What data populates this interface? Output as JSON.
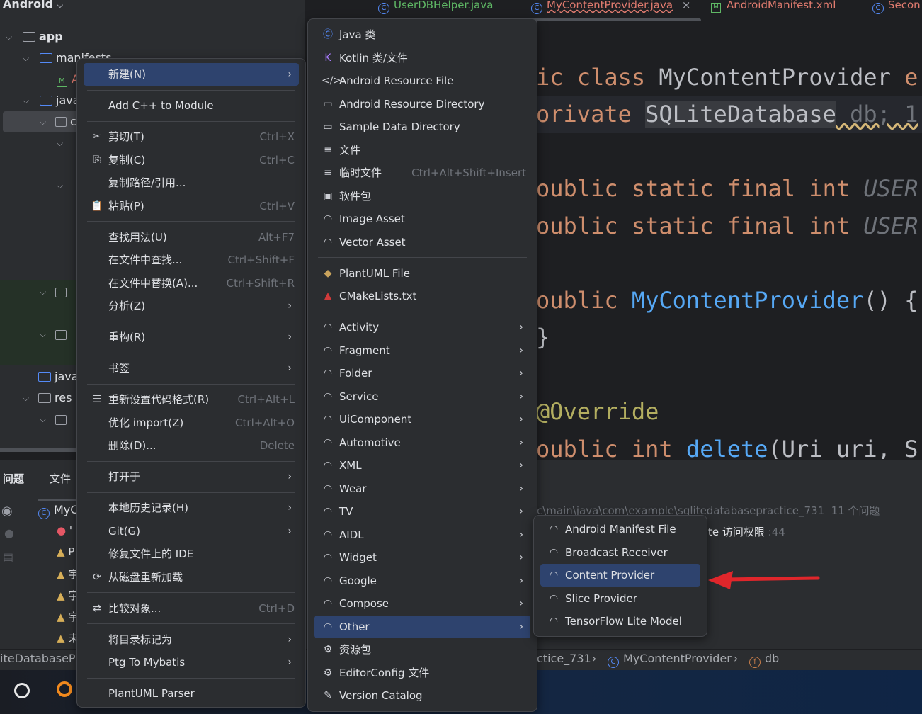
{
  "project": {
    "view_label": "Android",
    "tree": [
      {
        "label": "app",
        "depth": 0,
        "icon": "module-folder-icon"
      },
      {
        "label": "manifests",
        "depth": 1,
        "icon": "folder-icon"
      },
      {
        "label": "A",
        "depth": 2,
        "icon": "manifest-icon"
      },
      {
        "label": "java",
        "depth": 1,
        "icon": "folder-icon"
      },
      {
        "label": "c",
        "depth": 2,
        "icon": "package-icon"
      }
    ],
    "lower_tree": [
      {
        "label": "java",
        "icon": "generated-java-folder-icon"
      },
      {
        "label": "res",
        "icon": "res-folder-icon"
      }
    ]
  },
  "tabs": [
    {
      "label": "UserDBHelper.java",
      "color": "#5fb865"
    },
    {
      "label": "MyContentProvider.java",
      "color": "#e07b6f",
      "active": true
    },
    {
      "label": "AndroidManifest.xml",
      "color": "#e07b6f"
    },
    {
      "label": "Secon",
      "color": "#e07b6f"
    }
  ],
  "code": [
    [
      "ic class ",
      "MyContentProvider",
      " e"
    ],
    [
      "orivate ",
      "SQLiteDatabase",
      " db; 1"
    ],
    [
      "oublic static final int ",
      "USER"
    ],
    [
      "oublic static final int ",
      "USER"
    ],
    [
      "oublic ",
      "MyContentProvider",
      "() {"
    ],
    [
      "}"
    ],
    [
      "@Override"
    ],
    [
      "oublic int ",
      "delete",
      "(Uri uri, S"
    ]
  ],
  "bottom": {
    "tabs": [
      "问题",
      "文件"
    ],
    "file_row": "MyC",
    "path": "c\\main\\java\\com\\example\\sqlitedatabasepractice_731  11 个问题",
    "problem_text": "te 访问权限",
    "problem_line": ":44",
    "rows": [
      "'",
      "P",
      "宇",
      "宇",
      "宇",
      "未"
    ]
  },
  "breadcrumb": {
    "left": "iteDatabasePra",
    "pkg": "ctice_731",
    "class": "MyContentProvider",
    "field": "db"
  },
  "menu1": [
    {
      "label": "新建(N)",
      "submenu": true,
      "selected": true
    },
    {
      "sep": true
    },
    {
      "label": "Add C++ to Module"
    },
    {
      "sep": true
    },
    {
      "label": "剪切(T)",
      "shortcut": "Ctrl+X",
      "icon": "✂",
      "name": "cut"
    },
    {
      "label": "复制(C)",
      "shortcut": "Ctrl+C",
      "icon": "⎘",
      "name": "copy"
    },
    {
      "label": "复制路径/引用..."
    },
    {
      "label": "粘贴(P)",
      "shortcut": "Ctrl+V",
      "icon": "📋",
      "name": "paste"
    },
    {
      "sep": true
    },
    {
      "label": "查找用法(U)",
      "shortcut": "Alt+F7"
    },
    {
      "label": "在文件中查找...",
      "shortcut": "Ctrl+Shift+F"
    },
    {
      "label": "在文件中替换(A)...",
      "shortcut": "Ctrl+Shift+R"
    },
    {
      "label": "分析(Z)",
      "submenu": true
    },
    {
      "sep": true
    },
    {
      "label": "重构(R)",
      "submenu": true
    },
    {
      "sep": true
    },
    {
      "label": "书签",
      "submenu": true
    },
    {
      "sep": true
    },
    {
      "label": "重新设置代码格式(R)",
      "shortcut": "Ctrl+Alt+L",
      "icon": "☰",
      "name": "reformat"
    },
    {
      "label": "优化 import(Z)",
      "shortcut": "Ctrl+Alt+O"
    },
    {
      "label": "删除(D)...",
      "shortcut": "Delete"
    },
    {
      "sep": true
    },
    {
      "label": "打开于",
      "submenu": true
    },
    {
      "sep": true
    },
    {
      "label": "本地历史记录(H)",
      "submenu": true
    },
    {
      "label": "Git(G)",
      "submenu": true
    },
    {
      "label": "修复文件上的 IDE"
    },
    {
      "label": "从磁盘重新加载",
      "icon": "⟳",
      "name": "reload"
    },
    {
      "sep": true
    },
    {
      "label": "比较对象...",
      "shortcut": "Ctrl+D",
      "icon": "⇄",
      "name": "compare"
    },
    {
      "sep": true
    },
    {
      "label": "将目录标记为",
      "submenu": true
    },
    {
      "label": "Ptg To Mybatis",
      "submenu": true
    },
    {
      "sep": true
    },
    {
      "label": "PlantUML Parser"
    }
  ],
  "menu2": [
    {
      "label": "Java 类",
      "icon": "Ⓒ",
      "name": "java-class"
    },
    {
      "label": "Kotlin 类/文件",
      "icon": "K",
      "name": "kotlin"
    },
    {
      "label": "Android Resource File",
      "icon": "</>",
      "name": "xml"
    },
    {
      "label": "Android Resource Directory",
      "icon": "▭",
      "name": "folder"
    },
    {
      "label": "Sample Data Directory",
      "icon": "▭",
      "name": "folder"
    },
    {
      "label": "文件",
      "icon": "≡",
      "name": "file"
    },
    {
      "label": "临时文件",
      "shortcut": "Ctrl+Alt+Shift+Insert",
      "icon": "≡",
      "name": "scratch"
    },
    {
      "label": "软件包",
      "icon": "▣",
      "name": "package"
    },
    {
      "label": "Image Asset",
      "icon": "◠",
      "name": "android"
    },
    {
      "label": "Vector Asset",
      "icon": "◠",
      "name": "android"
    },
    {
      "sep": true
    },
    {
      "label": "PlantUML File",
      "icon": "◆",
      "name": "plantuml"
    },
    {
      "label": "CMakeLists.txt",
      "icon": "▲",
      "name": "cmake"
    },
    {
      "sep": true
    },
    {
      "label": "Activity",
      "submenu": true,
      "icon": "◠",
      "name": "android"
    },
    {
      "label": "Fragment",
      "submenu": true,
      "icon": "◠",
      "name": "android"
    },
    {
      "label": "Folder",
      "submenu": true,
      "icon": "◠",
      "name": "android"
    },
    {
      "label": "Service",
      "submenu": true,
      "icon": "◠",
      "name": "android"
    },
    {
      "label": "UiComponent",
      "submenu": true,
      "icon": "◠",
      "name": "android"
    },
    {
      "label": "Automotive",
      "submenu": true,
      "icon": "◠",
      "name": "android"
    },
    {
      "label": "XML",
      "submenu": true,
      "icon": "◠",
      "name": "android"
    },
    {
      "label": "Wear",
      "submenu": true,
      "icon": "◠",
      "name": "android"
    },
    {
      "label": "TV",
      "submenu": true,
      "icon": "◠",
      "name": "android"
    },
    {
      "label": "AIDL",
      "submenu": true,
      "icon": "◠",
      "name": "android"
    },
    {
      "label": "Widget",
      "submenu": true,
      "icon": "◠",
      "name": "android"
    },
    {
      "label": "Google",
      "submenu": true,
      "icon": "◠",
      "name": "android"
    },
    {
      "label": "Compose",
      "submenu": true,
      "icon": "◠",
      "name": "android"
    },
    {
      "label": "Other",
      "submenu": true,
      "selected": true,
      "icon": "◠",
      "name": "android"
    },
    {
      "label": "资源包",
      "icon": "⚙",
      "name": "gear"
    },
    {
      "label": "EditorConfig 文件",
      "icon": "⚙",
      "name": "gear"
    },
    {
      "label": "Version Catalog",
      "icon": "✎",
      "name": "catalog"
    }
  ],
  "menu3": [
    {
      "label": "Android Manifest File",
      "icon": "◠",
      "name": "android-file"
    },
    {
      "label": "Broadcast Receiver",
      "icon": "◠",
      "name": "android-file"
    },
    {
      "label": "Content Provider",
      "selected": true,
      "icon": "◠",
      "name": "android-file"
    },
    {
      "label": "Slice Provider",
      "icon": "◠",
      "name": "android-file"
    },
    {
      "label": "TensorFlow Lite Model",
      "icon": "◠",
      "name": "android-file"
    }
  ],
  "colors": {
    "menu_bg": "#2b2d30",
    "selection": "#2e436e",
    "annotation_arrow": "#e0262b",
    "keyword": "#cf8e6d"
  }
}
